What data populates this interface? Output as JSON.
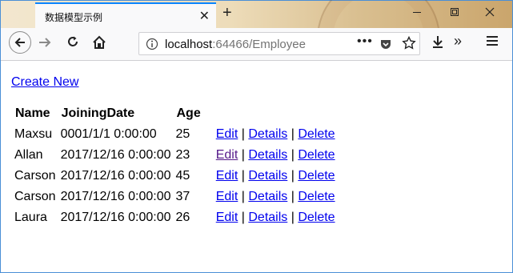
{
  "browser": {
    "tab_title": "数据模型示例",
    "tab_close_glyph": "✕",
    "new_tab_glyph": "+",
    "url_host": "localhost",
    "url_rest": ":64466/Employee",
    "page_actions_glyph": "•••",
    "more_tools_glyph": "»"
  },
  "page": {
    "create_new_label": "Create New",
    "table": {
      "headers": [
        "Name",
        "JoiningDate",
        "Age"
      ],
      "rows": [
        {
          "name": "Maxsu",
          "joining_date": "0001/1/1 0:00:00",
          "age": "25"
        },
        {
          "name": "Allan",
          "joining_date": "2017/12/16 0:00:00",
          "age": "23"
        },
        {
          "name": "Carson",
          "joining_date": "2017/12/16 0:00:00",
          "age": "45"
        },
        {
          "name": "Carson",
          "joining_date": "2017/12/16 0:00:00",
          "age": "37"
        },
        {
          "name": "Laura",
          "joining_date": "2017/12/16 0:00:00",
          "age": "26"
        }
      ],
      "actions": {
        "edit": "Edit",
        "details": "Details",
        "delete": "Delete",
        "separator": "|"
      }
    }
  },
  "colors": {
    "link": "#0000ee",
    "link_visited": "#551a8b",
    "tab_accent": "#0a84ff",
    "window_border": "#4a8fd6"
  }
}
